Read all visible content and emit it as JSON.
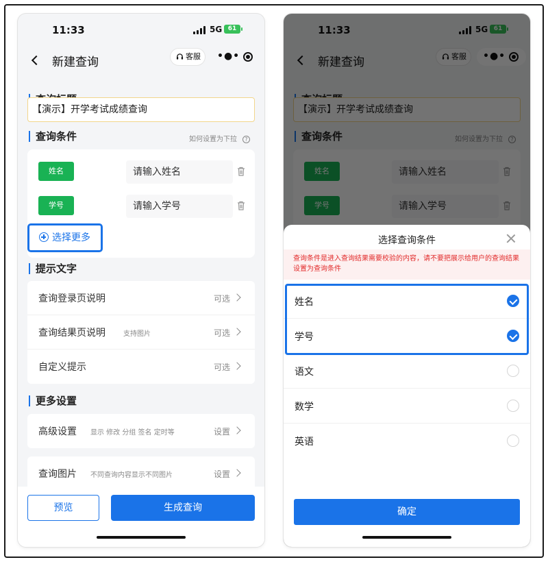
{
  "status": {
    "time": "11:33",
    "network": "5G",
    "battery": "61"
  },
  "nav": {
    "title": "新建查询",
    "service_label": "客服",
    "more_icon": "more-dots-icon",
    "record_icon": "record-icon"
  },
  "form": {
    "title_section": "查询标题",
    "title_value": "【演示】开学考试成绩查询",
    "conditions_section": "查询条件",
    "conditions_hint": "如何设置为下拉",
    "conditions": [
      {
        "tag": "姓名",
        "placeholder": "请输入姓名"
      },
      {
        "tag": "学号",
        "placeholder": "请输入学号"
      }
    ],
    "select_more": "选择更多",
    "tips_section": "提示文字",
    "tips": [
      {
        "label": "查询登录页说明",
        "sub": "",
        "value": "可选"
      },
      {
        "label": "查询结果页说明",
        "sub": "支持图片",
        "value": "可选"
      },
      {
        "label": "自定义提示",
        "sub": "",
        "value": "可选"
      }
    ],
    "more_section": "更多设置",
    "more": [
      {
        "label": "高级设置",
        "sub": "显示 修改 分组 签名 定时等",
        "value": "设置"
      },
      {
        "label": "查询图片",
        "sub": "不同查询内容显示不同图片",
        "value": "设置"
      }
    ]
  },
  "footer": {
    "preview": "预览",
    "generate": "生成查询"
  },
  "sheet": {
    "title": "选择查询条件",
    "warning": "查询条件是进入查询结果需要校验的内容，请不要把展示给用户的查询结果设置为查询条件",
    "options": [
      {
        "label": "姓名",
        "checked": true
      },
      {
        "label": "学号",
        "checked": true
      },
      {
        "label": "语文",
        "checked": false
      },
      {
        "label": "数学",
        "checked": false
      },
      {
        "label": "英语",
        "checked": false
      }
    ],
    "confirm": "确定"
  },
  "colors": {
    "accent": "#1a73e8",
    "tag_green": "#19b254",
    "warning_red": "#e22b2b",
    "battery_green": "#38c05a"
  }
}
